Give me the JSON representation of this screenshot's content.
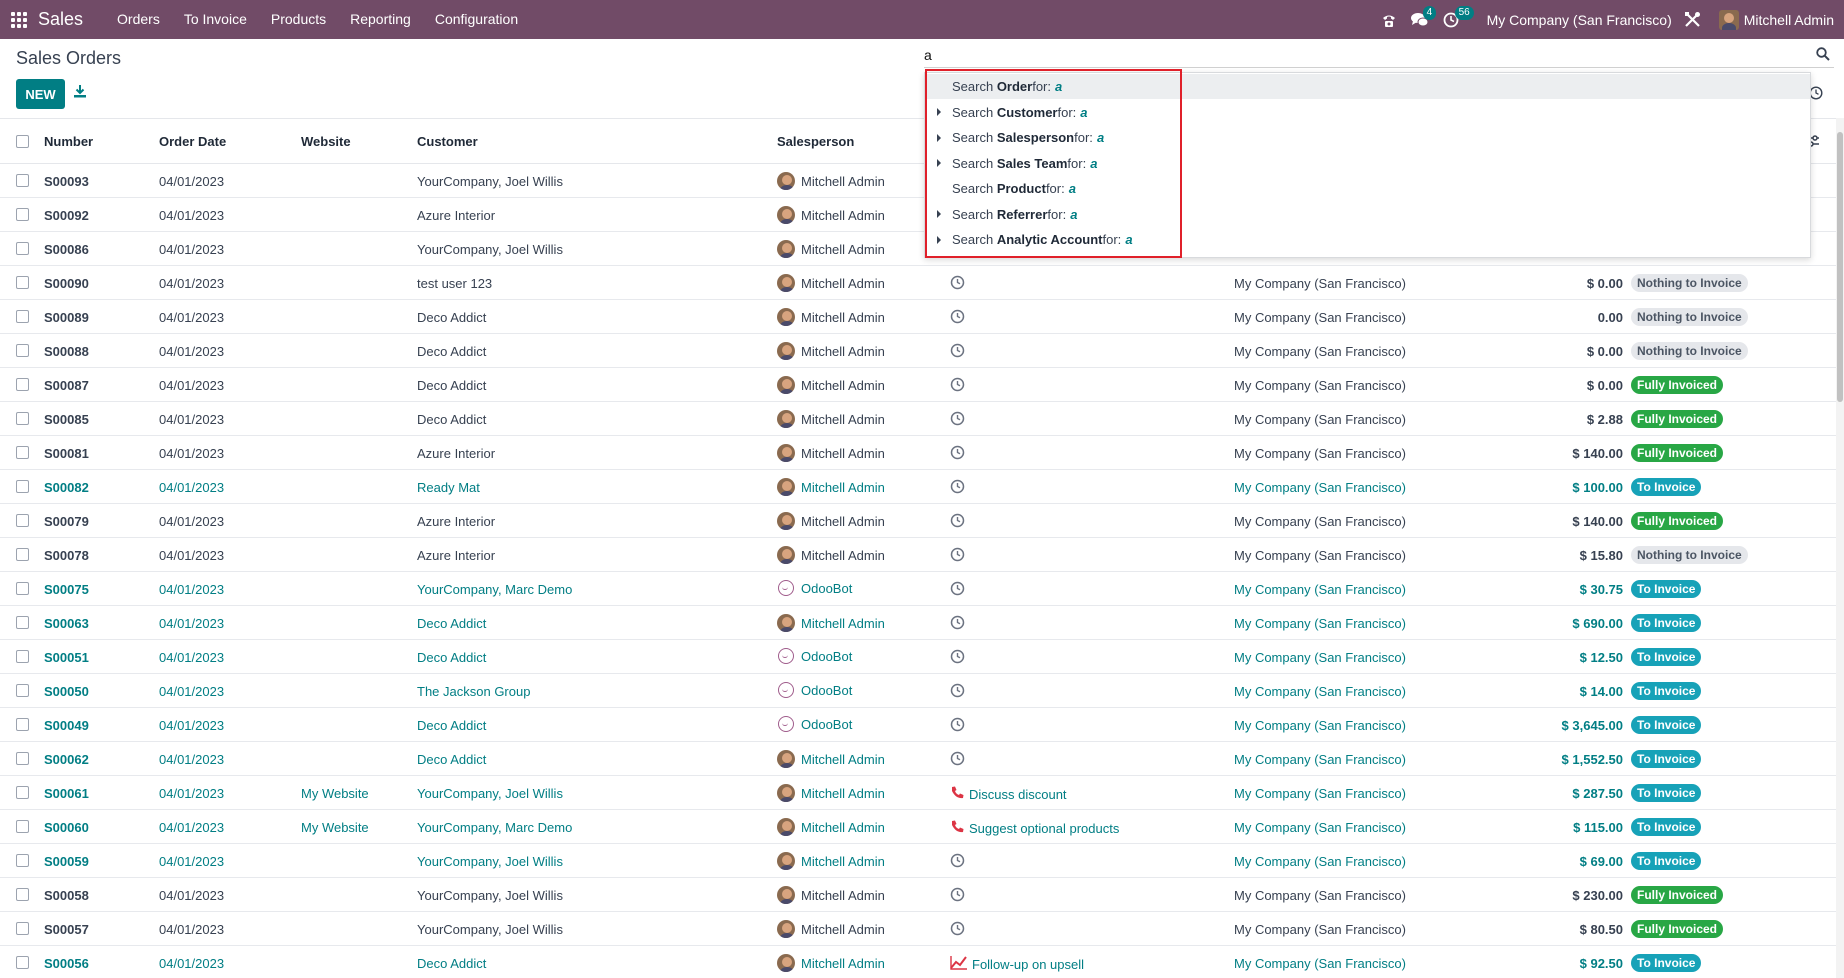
{
  "navbar": {
    "app_name": "Sales",
    "menu": [
      "Orders",
      "To Invoice",
      "Products",
      "Reporting",
      "Configuration"
    ],
    "messages_count": "4",
    "activities_count": "56",
    "company": "My Company (San Francisco)",
    "user": "Mitchell Admin",
    "color": "#714B67"
  },
  "control": {
    "title": "Sales Orders",
    "new_label": "NEW",
    "search_value": "a"
  },
  "search_dropdown": [
    {
      "prefix": "Search ",
      "field": "Order",
      "suffix": " for:",
      "term": "a",
      "expandable": false
    },
    {
      "prefix": "Search ",
      "field": "Customer",
      "suffix": " for:",
      "term": "a",
      "expandable": true
    },
    {
      "prefix": "Search ",
      "field": "Salesperson",
      "suffix": " for:",
      "term": "a",
      "expandable": true
    },
    {
      "prefix": "Search ",
      "field": "Sales Team",
      "suffix": " for:",
      "term": "a",
      "expandable": true
    },
    {
      "prefix": "Search ",
      "field": "Product",
      "suffix": " for:",
      "term": "a",
      "expandable": false
    },
    {
      "prefix": "Search ",
      "field": "Referrer",
      "suffix": " for:",
      "term": "a",
      "expandable": true
    },
    {
      "prefix": "Search ",
      "field": "Analytic Account",
      "suffix": " for:",
      "term": "a",
      "expandable": true
    }
  ],
  "table": {
    "headers": {
      "number": "Number",
      "order_date": "Order Date",
      "website": "Website",
      "customer": "Customer",
      "salesperson": "Salesperson"
    },
    "rows": [
      {
        "number": "S00093",
        "date": "04/01/2023",
        "website": "",
        "customer": "YourCompany, Joel Willis",
        "salesperson": "Mitchell Admin",
        "bot": false,
        "activity": "",
        "activity_icon": "clock",
        "company": "",
        "total": "",
        "status": "",
        "status_kind": "",
        "link": false
      },
      {
        "number": "S00092",
        "date": "04/01/2023",
        "website": "",
        "customer": "Azure Interior",
        "salesperson": "Mitchell Admin",
        "bot": false,
        "activity": "",
        "activity_icon": "clock",
        "company": "",
        "total": "",
        "status": "",
        "status_kind": "",
        "link": false
      },
      {
        "number": "S00086",
        "date": "04/01/2023",
        "website": "",
        "customer": "YourCompany, Joel Willis",
        "salesperson": "Mitchell Admin",
        "bot": false,
        "activity": "",
        "activity_icon": "clock",
        "company": "",
        "total": "",
        "status": "",
        "status_kind": "",
        "link": false
      },
      {
        "number": "S00090",
        "date": "04/01/2023",
        "website": "",
        "customer": "test user 123",
        "salesperson": "Mitchell Admin",
        "bot": false,
        "activity": "",
        "activity_icon": "clock",
        "company": "My Company (San Francisco)",
        "total": "$ 0.00",
        "status": "Nothing to Invoice",
        "status_kind": "nothing",
        "link": false
      },
      {
        "number": "S00089",
        "date": "04/01/2023",
        "website": "",
        "customer": "Deco Addict",
        "salesperson": "Mitchell Admin",
        "bot": false,
        "activity": "",
        "activity_icon": "clock",
        "company": "My Company (San Francisco)",
        "total": "0.00",
        "status": "Nothing to Invoice",
        "status_kind": "nothing",
        "link": false
      },
      {
        "number": "S00088",
        "date": "04/01/2023",
        "website": "",
        "customer": "Deco Addict",
        "salesperson": "Mitchell Admin",
        "bot": false,
        "activity": "",
        "activity_icon": "clock",
        "company": "My Company (San Francisco)",
        "total": "$ 0.00",
        "status": "Nothing to Invoice",
        "status_kind": "nothing",
        "link": false
      },
      {
        "number": "S00087",
        "date": "04/01/2023",
        "website": "",
        "customer": "Deco Addict",
        "salesperson": "Mitchell Admin",
        "bot": false,
        "activity": "",
        "activity_icon": "clock",
        "company": "My Company (San Francisco)",
        "total": "$ 0.00",
        "status": "Fully Invoiced",
        "status_kind": "fully",
        "link": false
      },
      {
        "number": "S00085",
        "date": "04/01/2023",
        "website": "",
        "customer": "Deco Addict",
        "salesperson": "Mitchell Admin",
        "bot": false,
        "activity": "",
        "activity_icon": "clock",
        "company": "My Company (San Francisco)",
        "total": "$ 2.88",
        "status": "Fully Invoiced",
        "status_kind": "fully",
        "link": false
      },
      {
        "number": "S00081",
        "date": "04/01/2023",
        "website": "",
        "customer": "Azure Interior",
        "salesperson": "Mitchell Admin",
        "bot": false,
        "activity": "",
        "activity_icon": "clock",
        "company": "My Company (San Francisco)",
        "total": "$ 140.00",
        "status": "Fully Invoiced",
        "status_kind": "fully",
        "link": false
      },
      {
        "number": "S00082",
        "date": "04/01/2023",
        "website": "",
        "customer": "Ready Mat",
        "salesperson": "Mitchell Admin",
        "bot": false,
        "activity": "",
        "activity_icon": "clock",
        "company": "My Company (San Francisco)",
        "total": "$ 100.00",
        "status": "To Invoice",
        "status_kind": "to",
        "link": true
      },
      {
        "number": "S00079",
        "date": "04/01/2023",
        "website": "",
        "customer": "Azure Interior",
        "salesperson": "Mitchell Admin",
        "bot": false,
        "activity": "",
        "activity_icon": "clock",
        "company": "My Company (San Francisco)",
        "total": "$ 140.00",
        "status": "Fully Invoiced",
        "status_kind": "fully",
        "link": false
      },
      {
        "number": "S00078",
        "date": "04/01/2023",
        "website": "",
        "customer": "Azure Interior",
        "salesperson": "Mitchell Admin",
        "bot": false,
        "activity": "",
        "activity_icon": "clock",
        "company": "My Company (San Francisco)",
        "total": "$ 15.80",
        "status": "Nothing to Invoice",
        "status_kind": "nothing",
        "link": false
      },
      {
        "number": "S00075",
        "date": "04/01/2023",
        "website": "",
        "customer": "YourCompany, Marc Demo",
        "salesperson": "OdooBot",
        "bot": true,
        "activity": "",
        "activity_icon": "clock",
        "company": "My Company (San Francisco)",
        "total": "$ 30.75",
        "status": "To Invoice",
        "status_kind": "to",
        "link": true
      },
      {
        "number": "S00063",
        "date": "04/01/2023",
        "website": "",
        "customer": "Deco Addict",
        "salesperson": "Mitchell Admin",
        "bot": false,
        "activity": "",
        "activity_icon": "clock",
        "company": "My Company (San Francisco)",
        "total": "$ 690.00",
        "status": "To Invoice",
        "status_kind": "to",
        "link": true
      },
      {
        "number": "S00051",
        "date": "04/01/2023",
        "website": "",
        "customer": "Deco Addict",
        "salesperson": "OdooBot",
        "bot": true,
        "activity": "",
        "activity_icon": "clock",
        "company": "My Company (San Francisco)",
        "total": "$ 12.50",
        "status": "To Invoice",
        "status_kind": "to",
        "link": true
      },
      {
        "number": "S00050",
        "date": "04/01/2023",
        "website": "",
        "customer": "The Jackson Group",
        "salesperson": "OdooBot",
        "bot": true,
        "activity": "",
        "activity_icon": "clock",
        "company": "My Company (San Francisco)",
        "total": "$ 14.00",
        "status": "To Invoice",
        "status_kind": "to",
        "link": true
      },
      {
        "number": "S00049",
        "date": "04/01/2023",
        "website": "",
        "customer": "Deco Addict",
        "salesperson": "OdooBot",
        "bot": true,
        "activity": "",
        "activity_icon": "clock",
        "company": "My Company (San Francisco)",
        "total": "$ 3,645.00",
        "status": "To Invoice",
        "status_kind": "to",
        "link": true
      },
      {
        "number": "S00062",
        "date": "04/01/2023",
        "website": "",
        "customer": "Deco Addict",
        "salesperson": "Mitchell Admin",
        "bot": false,
        "activity": "",
        "activity_icon": "clock",
        "company": "My Company (San Francisco)",
        "total": "$ 1,552.50",
        "status": "To Invoice",
        "status_kind": "to",
        "link": true
      },
      {
        "number": "S00061",
        "date": "04/01/2023",
        "website": "My Website",
        "customer": "YourCompany, Joel Willis",
        "salesperson": "Mitchell Admin",
        "bot": false,
        "activity": "Discuss discount",
        "activity_icon": "phone",
        "company": "My Company (San Francisco)",
        "total": "$ 287.50",
        "status": "To Invoice",
        "status_kind": "to",
        "link": true
      },
      {
        "number": "S00060",
        "date": "04/01/2023",
        "website": "My Website",
        "customer": "YourCompany, Marc Demo",
        "salesperson": "Mitchell Admin",
        "bot": false,
        "activity": "Suggest optional products",
        "activity_icon": "phone",
        "company": "My Company (San Francisco)",
        "total": "$ 115.00",
        "status": "To Invoice",
        "status_kind": "to",
        "link": true
      },
      {
        "number": "S00059",
        "date": "04/01/2023",
        "website": "",
        "customer": "YourCompany, Joel Willis",
        "salesperson": "Mitchell Admin",
        "bot": false,
        "activity": "",
        "activity_icon": "clock",
        "company": "My Company (San Francisco)",
        "total": "$ 69.00",
        "status": "To Invoice",
        "status_kind": "to",
        "link": true
      },
      {
        "number": "S00058",
        "date": "04/01/2023",
        "website": "",
        "customer": "YourCompany, Joel Willis",
        "salesperson": "Mitchell Admin",
        "bot": false,
        "activity": "",
        "activity_icon": "clock",
        "company": "My Company (San Francisco)",
        "total": "$ 230.00",
        "status": "Fully Invoiced",
        "status_kind": "fully",
        "link": false
      },
      {
        "number": "S00057",
        "date": "04/01/2023",
        "website": "",
        "customer": "YourCompany, Joel Willis",
        "salesperson": "Mitchell Admin",
        "bot": false,
        "activity": "",
        "activity_icon": "clock",
        "company": "My Company (San Francisco)",
        "total": "$ 80.50",
        "status": "Fully Invoiced",
        "status_kind": "fully",
        "link": false
      },
      {
        "number": "S00056",
        "date": "04/01/2023",
        "website": "",
        "customer": "Deco Addict",
        "salesperson": "Mitchell Admin",
        "bot": false,
        "activity": "Follow-up on upsell",
        "activity_icon": "chart",
        "company": "My Company (San Francisco)",
        "total": "$ 92.50",
        "status": "To Invoice",
        "status_kind": "to",
        "link": true
      }
    ]
  }
}
